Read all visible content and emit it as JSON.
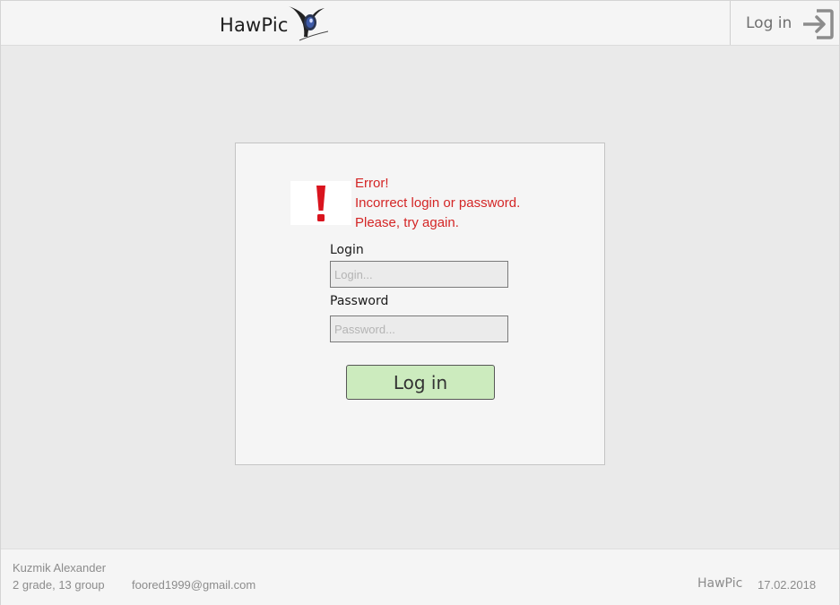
{
  "header": {
    "brand": "HawPic",
    "login_label": "Log in",
    "icons": {
      "logo": "camera-lens-logo-icon",
      "login": "sign-in-arrow-icon"
    }
  },
  "login_card": {
    "error": {
      "icon": "exclamation-icon",
      "color": "#d42626",
      "title": "Error!",
      "line1": "Incorrect login or password.",
      "line2": "Please, try again."
    },
    "login_label": "Login",
    "login_placeholder": "Login...",
    "login_value": "",
    "password_label": "Password",
    "password_placeholder": "Password...",
    "password_value": "",
    "submit_label": "Log in",
    "submit_color": "#ccebbe"
  },
  "footer": {
    "author": "Kuzmik Alexander",
    "group": "2 grade, 13 group",
    "email": "foored1999@gmail.com",
    "brand": "HawPic",
    "date": "17.02.2018"
  }
}
